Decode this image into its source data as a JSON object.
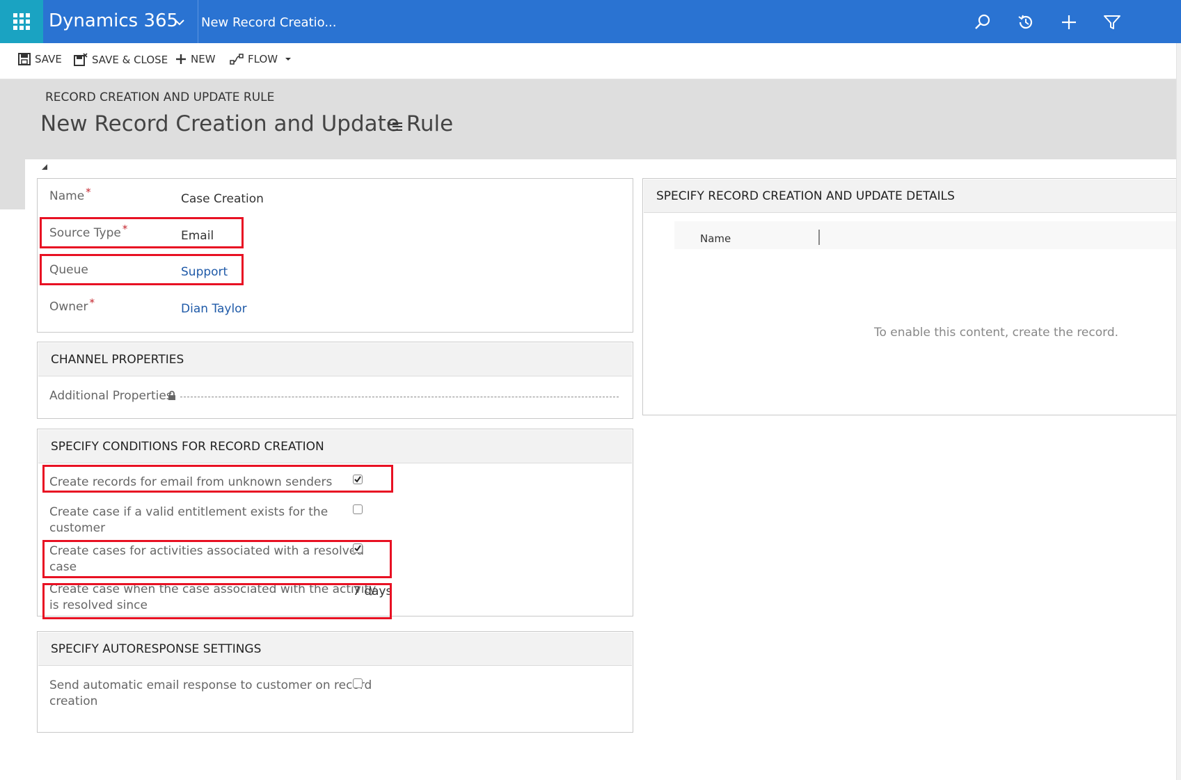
{
  "topbar": {
    "brand": "Dynamics 365",
    "record_tab": "New Record Creatio...",
    "icons": [
      "app-launcher-icon",
      "chevron-down-icon",
      "search-icon",
      "recent-history-icon",
      "plus-icon",
      "filter-icon"
    ],
    "colors": {
      "bar": "#2a73d2",
      "launcher": "#1aa3c2"
    }
  },
  "commands": {
    "save": "SAVE",
    "save_close": "SAVE & CLOSE",
    "new": "NEW",
    "flow": "FLOW"
  },
  "header": {
    "entity_type": "RECORD CREATION AND UPDATE RULE",
    "title": "New Record Creation and Update Rule"
  },
  "general": {
    "name_label": "Name",
    "name_value": "Case Creation",
    "source_type_label": "Source Type",
    "source_type_value": "Email",
    "queue_label": "Queue",
    "queue_value": "Support",
    "owner_label": "Owner",
    "owner_value": "Dian Taylor",
    "required_mark": "*"
  },
  "channel": {
    "title": "CHANNEL PROPERTIES",
    "additional_label": "Additional Properties"
  },
  "conditions": {
    "title": "SPECIFY CONDITIONS FOR RECORD CREATION",
    "unknown_senders_label": "Create records for email from unknown senders",
    "unknown_senders_checked": true,
    "entitlement_label_1": "Create case if a valid entitlement exists for the",
    "entitlement_label_2": "customer",
    "entitlement_checked": false,
    "resolved_case_label_1": "Create cases for activities associated with a resolved",
    "resolved_case_label_2": "case",
    "resolved_case_checked": true,
    "resolved_since_label_1": "Create case when the case associated with the activity",
    "resolved_since_label_2": "is resolved since",
    "resolved_since_value": "7 days"
  },
  "autoresponse": {
    "title": "SPECIFY AUTORESPONSE SETTINGS",
    "send_label_1": "Send automatic email response to customer on record",
    "send_label_2": "creation",
    "send_checked": false
  },
  "details": {
    "title": "SPECIFY RECORD CREATION AND UPDATE DETAILS",
    "column_name": "Name",
    "empty_message": "To enable this content, create the record."
  }
}
